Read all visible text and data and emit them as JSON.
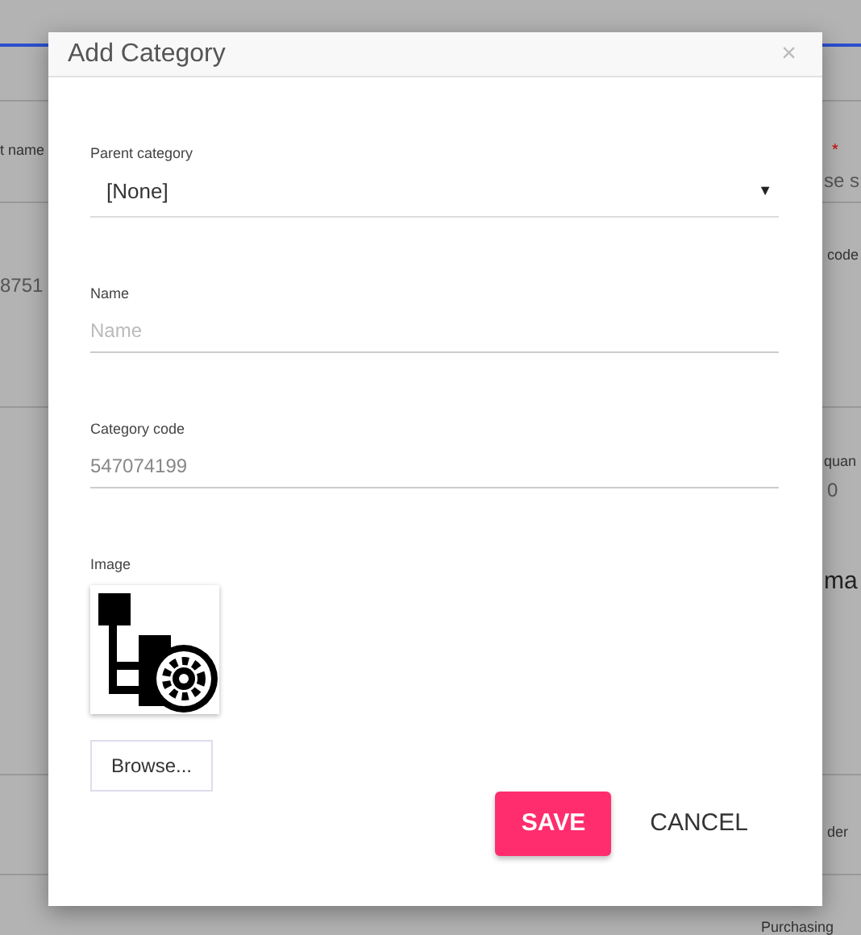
{
  "background": {
    "fragments": [
      {
        "kind": "label",
        "text": "t name"
      },
      {
        "kind": "value",
        "text": "8751"
      },
      {
        "kind": "required",
        "text": "*"
      },
      {
        "kind": "value",
        "text": "se s"
      },
      {
        "kind": "label",
        "text": "code"
      },
      {
        "kind": "label",
        "text": "quan"
      },
      {
        "kind": "value",
        "text": "0"
      },
      {
        "kind": "heading",
        "text": "ma"
      },
      {
        "kind": "label",
        "text": "der"
      },
      {
        "kind": "label",
        "text": "Purchasing"
      }
    ]
  },
  "dialog": {
    "title": "Add Category",
    "close": "×",
    "fields": [
      {
        "kind": "select",
        "label": "Parent category",
        "value": "[None]",
        "caret": "▼"
      },
      {
        "kind": "text",
        "label": "Name",
        "placeholder": "Name"
      },
      {
        "kind": "text",
        "label": "Category code",
        "value": "547074199"
      },
      {
        "kind": "image",
        "label": "Image",
        "button": "Browse..."
      }
    ],
    "buttons": [
      {
        "kind": "primary",
        "label": "SAVE"
      },
      {
        "kind": "flat",
        "label": "CANCEL"
      }
    ]
  }
}
